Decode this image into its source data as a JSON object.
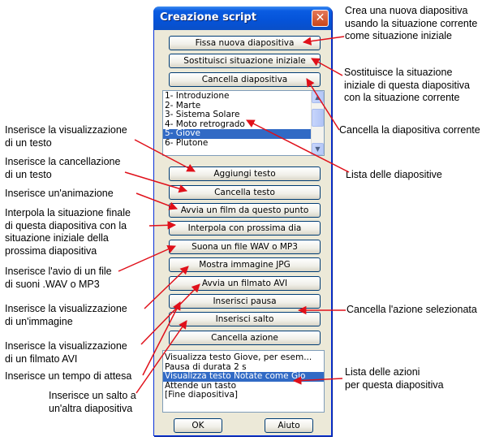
{
  "dialog": {
    "title": "Creazione script",
    "close_glyph": "✕",
    "buttons_top": [
      "Fissa nuova diapositiva",
      "Sostituisci situazione iniziale",
      "Cancella diapositiva"
    ],
    "slides": [
      "1- Introduzione",
      "2- Marte",
      "3- Sistema Solare",
      "4- Moto retrogrado",
      "5- Giove",
      "6- Plutone"
    ],
    "selected_slide": 4,
    "buttons_actions": [
      "Aggiungi testo",
      "Cancella testo",
      "Avvia un film da questo punto",
      "Interpola con prossima dia",
      "Suona un file WAV o MP3",
      "Mostra immagine JPG",
      "Avvia un filmato AVI",
      "Inserisci pausa",
      "Inserisci salto",
      "Cancella azione"
    ],
    "actions": [
      "Visualizza testo Giove, per esem...",
      "Pausa di durata 2 s",
      "Visualizza testo Notate come Gio",
      "Attende un tasto",
      "[Fine diapositiva]"
    ],
    "selected_action": 2,
    "ok_label": "OK",
    "help_label": "Aiuto"
  },
  "annotations": {
    "new_slide": "Crea una nuova diapositiva\nusando la situazione corrente\ncome situazione iniziale",
    "replace_initial": "Sostituisce la situazione\niniziale di questa diapositiva\ncon la situazione corrente",
    "delete_slide": "Cancella la diapositiva corrente",
    "slide_list": "Lista delle diapositive",
    "delete_action": "Cancella l'azione selezionata",
    "action_list": "Lista delle azioni\nper questa diapositiva",
    "show_text": "Inserisce la visualizzazione\ndi un testo",
    "delete_text": "Inserisce la cancellazione\ndi un testo",
    "animation": "Inserisce un'animazione",
    "interpolate": "Interpola la situazione finale\ndi questa diapositiva con la\nsituazione iniziale della\nprossima diapositiva",
    "sound": "Inserisce l'avio di un file\ndi suoni .WAV o MP3",
    "image": "Inserisce la visualizzazione\ndi un'immagine",
    "avi": "Inserisce la visualizzazione\ndi un filmato AVI",
    "pause": "Inserisce un tempo di attesa",
    "jump": "Inserisce un salto a\nun'altra diapositiva"
  },
  "colors": {
    "arrow": "#e0101a",
    "title_bar": "#0553d8",
    "selection": "#316ac5"
  }
}
